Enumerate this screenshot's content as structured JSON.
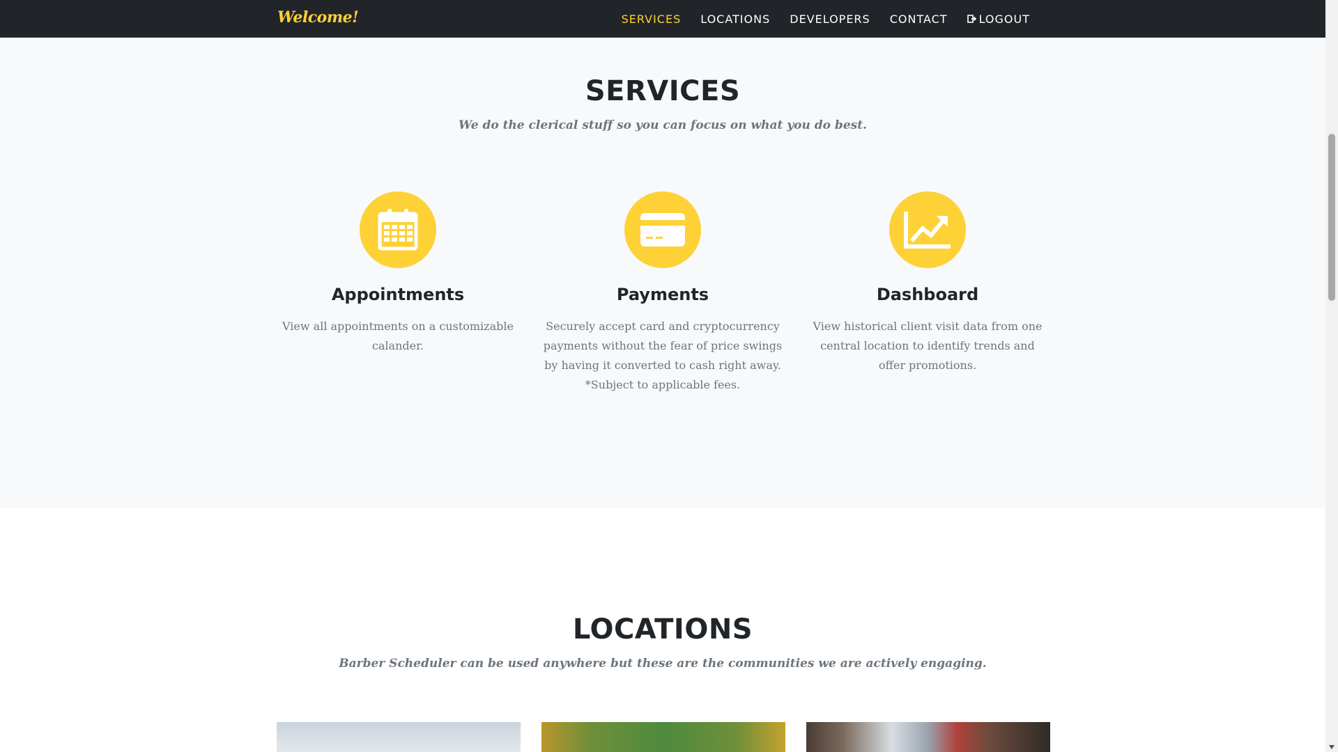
{
  "navbar": {
    "brand": "Welcome!",
    "items": [
      {
        "label": "SERVICES",
        "active": true
      },
      {
        "label": "LOCATIONS",
        "active": false
      },
      {
        "label": "DEVELOPERS",
        "active": false
      },
      {
        "label": "CONTACT",
        "active": false
      },
      {
        "label": "LOGOUT",
        "active": false,
        "icon": "sign-out-icon"
      }
    ]
  },
  "services": {
    "heading": "SERVICES",
    "subheading": "We do the clerical stuff so you can focus on what you do best.",
    "items": [
      {
        "icon": "calendar-icon",
        "title": "Appointments",
        "text": "View all appointments on a customizable calander."
      },
      {
        "icon": "credit-card-icon",
        "title": "Payments",
        "text": "Securely accept card and cryptocurrency payments without the fear of price swings by having it converted to cash right away. *Subject to applicable fees."
      },
      {
        "icon": "line-chart-icon",
        "title": "Dashboard",
        "text": "View historical client visit data from one central location to identify trends and offer promotions."
      }
    ]
  },
  "locations": {
    "heading": "LOCATIONS",
    "subheading": "Barber Scheduler can be used anywhere but these are the communities we are actively engaging."
  },
  "colors": {
    "accent": "#fed136",
    "navbar_bg": "#212529",
    "section_bg": "#f8f9fa",
    "muted_text": "#6c757d"
  }
}
